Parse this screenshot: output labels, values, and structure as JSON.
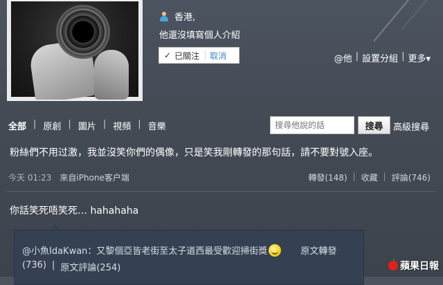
{
  "profile": {
    "location": "香港,",
    "bio": "他還沒填寫個人介紹"
  },
  "follow": {
    "checkmark": "✓",
    "followed_label": "已關注",
    "cancel_label": "取消"
  },
  "profile_links": {
    "at_him": "@他",
    "sep1": "|",
    "set_group": "設置分組",
    "sep2": "|",
    "more": "更多",
    "more_arrow": "▾"
  },
  "tabs": [
    {
      "label": "全部"
    },
    {
      "label": "原創"
    },
    {
      "label": "圖片"
    },
    {
      "label": "視頻"
    },
    {
      "label": "音樂"
    }
  ],
  "tab_separator": "|",
  "search": {
    "placeholder": "搜尋他說的話",
    "button_label": "搜尋",
    "advanced_label": "高級搜尋"
  },
  "post": {
    "text": "粉絲們不用过激，我並沒笑你們的偶像，只是笑我剛轉發的那句話，請不要對號入座。",
    "time": "今天 01:23",
    "source": "來自iPhone客户端",
    "forward": "轉發(148)",
    "favorite": "收藏",
    "comment": "評論(746)",
    "sep": "|"
  },
  "reply": {
    "text": "你話笑死唔笑死… hahahaha"
  },
  "quote": {
    "author_and_text": "@小魚IdaKwan：又黎個亞皆老街至太子道西最受歡迎掃街獎",
    "orig_forward": "原文轉發",
    "count_left": "(736)",
    "sep": "|",
    "orig_comment": "原文評論(254)"
  },
  "watermark": {
    "text": "蘋果日報"
  },
  "icons": {
    "user": "user-icon",
    "emoji": "smiley-icon",
    "apple": "apple-logo-icon"
  }
}
